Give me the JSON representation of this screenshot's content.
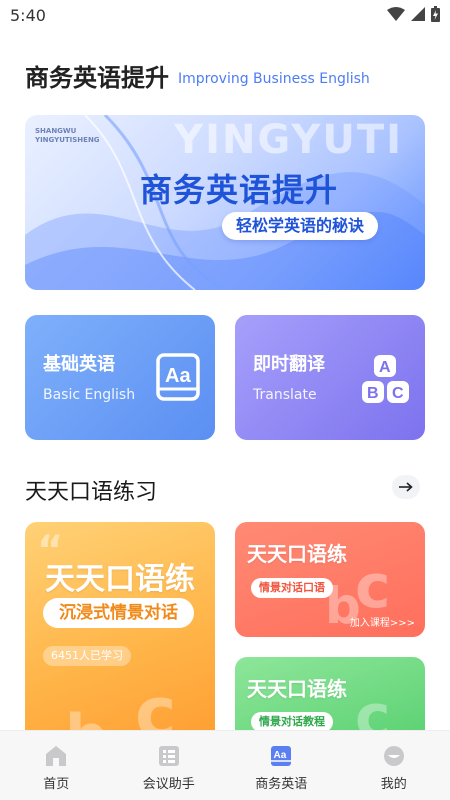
{
  "status_bar": {
    "time": "5:40"
  },
  "header": {
    "title": "商务英语提升",
    "subtitle": "Improving Business English"
  },
  "banner": {
    "tag_line1": "SHANGWU",
    "tag_line2": "YINGYUTISHENG",
    "bg_word": "YINGYUTI",
    "title": "商务英语提升",
    "pill": "轻松学英语的秘诀"
  },
  "features": [
    {
      "title": "基础英语",
      "subtitle": "Basic English",
      "icon": "aa-book-icon"
    },
    {
      "title": "即时翻译",
      "subtitle": "Translate",
      "icon": "abc-blocks-icon"
    }
  ],
  "section": {
    "title": "天天口语练习"
  },
  "practice": {
    "big": {
      "title": "天天口语练",
      "pill": "沉浸式情景对话",
      "count": "6451人已学习"
    },
    "red": {
      "title": "天天口语练",
      "tag": "情景对话口语",
      "join": "加入课程>>>"
    },
    "green": {
      "title": "天天口语练",
      "tag": "情景对话教程"
    }
  },
  "nav": [
    {
      "label": "首页",
      "icon": "home-icon"
    },
    {
      "label": "会议助手",
      "icon": "list-icon"
    },
    {
      "label": "商务英语",
      "icon": "aa-icon"
    },
    {
      "label": "我的",
      "icon": "profile-icon"
    }
  ],
  "colors": {
    "accent": "#4d7cf5",
    "nav_active": "#5b7ff2"
  }
}
